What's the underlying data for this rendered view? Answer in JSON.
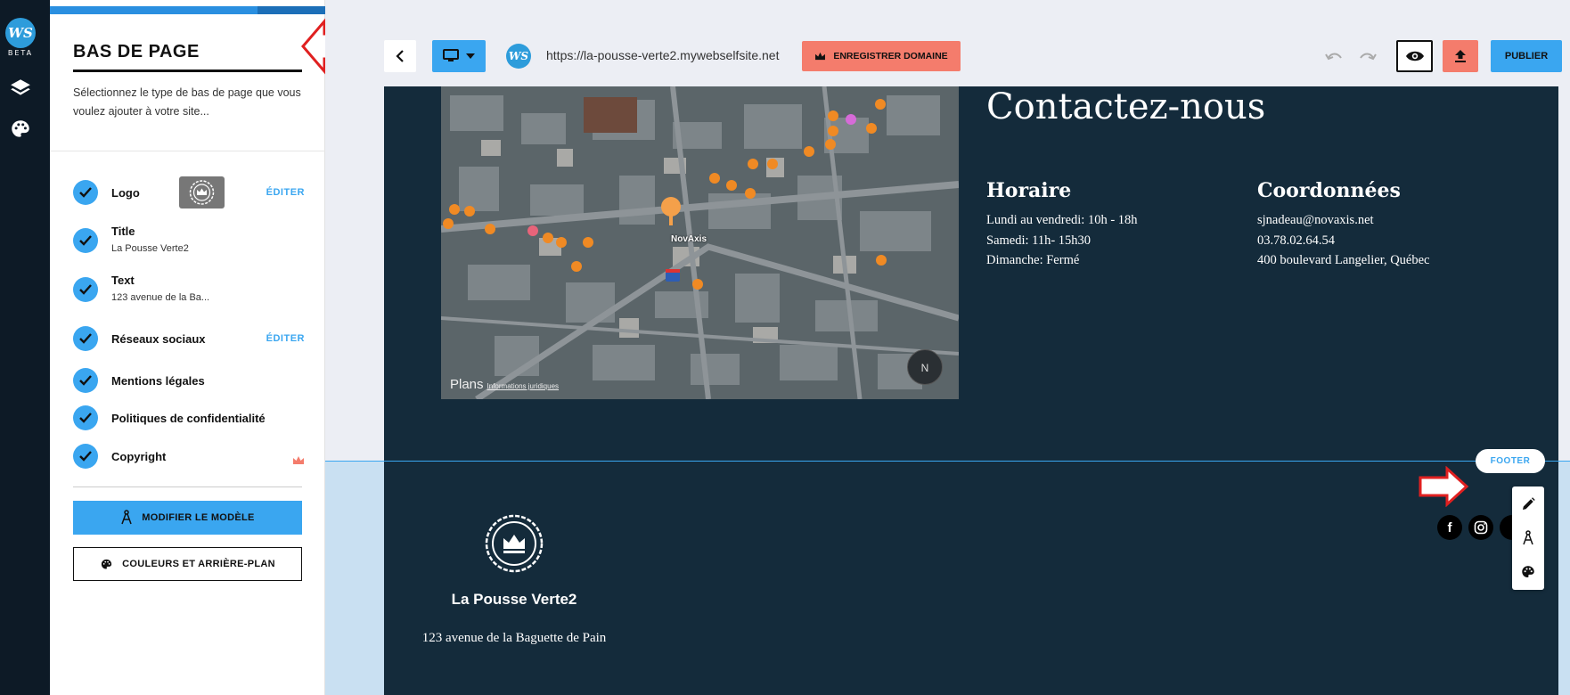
{
  "rail": {
    "logo_text": "WS",
    "beta_label": "BETA",
    "icons": [
      "layers-icon",
      "palette-icon"
    ]
  },
  "panel": {
    "title": "BAS DE PAGE",
    "description": "Sélectionnez le type de bas de page que vous voulez ajouter à votre site...",
    "items": [
      {
        "label": "Logo",
        "action": "ÉDITER"
      },
      {
        "label": "Title",
        "sub": "La Pousse Verte2"
      },
      {
        "label": "Text",
        "sub": "123 avenue de la Ba..."
      },
      {
        "label": "Réseaux sociaux",
        "action": "ÉDITER"
      },
      {
        "label": "Mentions légales"
      },
      {
        "label": "Politiques de confidentialité"
      },
      {
        "label": "Copyright",
        "premium_icon": "crown-icon"
      }
    ],
    "modify_template_label": "MODIFIER LE MODÈLE",
    "colors_bg_label": "COULEURS ET ARRIÈRE-PLAN"
  },
  "toolbar": {
    "site_badge": "WS",
    "url": "https://la-pousse-verte2.mywebselfsite.net",
    "domain_label": "ENREGISTRER DOMAINE",
    "publish_label": "PUBLIER"
  },
  "map": {
    "credit": "Plans",
    "credit_small": "Informations juridiques",
    "pin_label": "NovAxis",
    "compass": "N"
  },
  "contact": {
    "title": "Contactez-nous",
    "hours": {
      "heading": "Horaire",
      "lines": [
        "Lundi au vendredi: 10h - 18h",
        "Samedi: 11h- 15h30",
        "Dimanche: Fermé"
      ]
    },
    "coords": {
      "heading": "Coordonnées",
      "lines": [
        "sjnadeau@novaxis.net",
        "03.78.02.64.54",
        "400 boulevard Langelier, Québec"
      ]
    }
  },
  "footer": {
    "tag": "FOOTER",
    "site_name": "La Pousse Verte2",
    "address": "123 avenue de la Baguette de Pain",
    "social": [
      "f",
      "ig",
      "yt"
    ]
  },
  "colors": {
    "accent": "#3aa6f0",
    "domain": "#f47c6c",
    "canvas": "#142b3b",
    "rail": "#0d1a26"
  }
}
